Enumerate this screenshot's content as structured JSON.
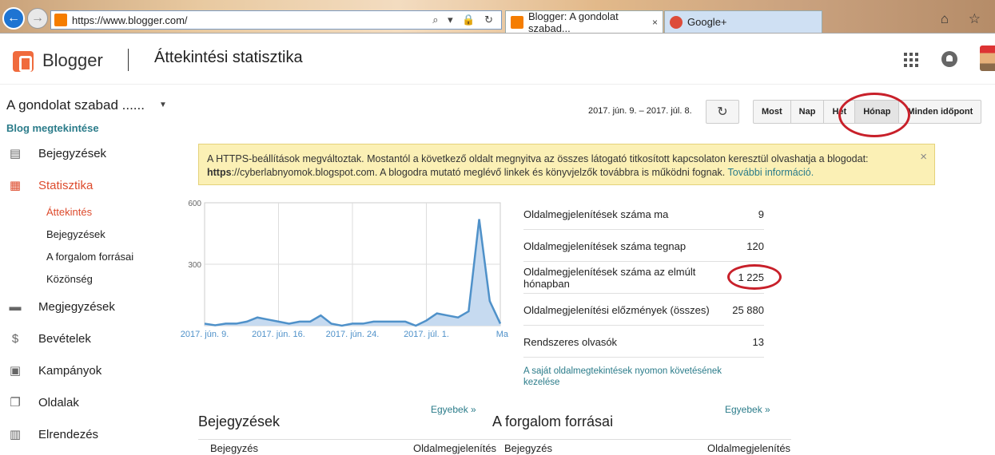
{
  "browser": {
    "url": "https://www.blogger.com/",
    "tabs": [
      {
        "label": "Blogger: A gondolat szabad...",
        "close": "×"
      },
      {
        "label": "Google+",
        "close": ""
      }
    ],
    "url_tools": "⌕ ▾ 🔒 ↻",
    "right_icons": "⌂ ☆"
  },
  "header": {
    "brand": "Blogger",
    "title": "Áttekintési statisztika"
  },
  "sidebar": {
    "blog_name": "A gondolat szabad ......",
    "caret": "▼",
    "view_blog": "Blog megtekintése",
    "items": [
      {
        "label": "Bejegyzések",
        "icon": "posts-icon",
        "glyph": "▤"
      },
      {
        "label": "Statisztika",
        "icon": "stats-icon",
        "glyph": "▦"
      },
      {
        "label": "Megjegyzések",
        "icon": "comments-icon",
        "glyph": "▬"
      },
      {
        "label": "Bevételek",
        "icon": "dollar-icon",
        "glyph": "$"
      },
      {
        "label": "Kampányok",
        "icon": "campaigns-icon",
        "glyph": "▣"
      },
      {
        "label": "Oldalak",
        "icon": "pages-icon",
        "glyph": "❐"
      },
      {
        "label": "Elrendezés",
        "icon": "layout-icon",
        "glyph": "▥"
      }
    ],
    "subitems": [
      "Áttekintés",
      "Bejegyzések",
      "A forgalom forrásai",
      "Közönség"
    ]
  },
  "range": {
    "date_range": "2017. jún. 9. – 2017. júl. 8.",
    "refresh": "↻",
    "buttons": [
      "Most",
      "Nap",
      "Hét",
      "Hónap",
      "Minden időpont"
    ],
    "selected": "Hónap"
  },
  "notice": {
    "text_a": "A HTTPS-beállítások megváltoztak. Mostantól a következő oldalt megnyitva az összes látogató titkosított kapcsolaton keresztül olvashatja a blogodat: ",
    "bold": "https",
    "text_b": "://cyberlabnyomok.blogspot.com. A blogodra mutató meglévő linkek és könyvjelzők továbbra is működni fognak. ",
    "link": "További információ.",
    "close": "×"
  },
  "chart_data": {
    "type": "area",
    "ylim": [
      0,
      600
    ],
    "yticks": [
      "600",
      "300"
    ],
    "xtick_labels": [
      "2017. jún. 9.",
      "2017. jún. 16.",
      "2017. jún. 24.",
      "2017. júl. 1.",
      "Ma"
    ],
    "color": "#4f91c9",
    "fill": "#c6daf0",
    "series": [
      {
        "values": [
          10,
          2,
          10,
          10,
          20,
          40,
          30,
          20,
          10,
          20,
          20,
          50,
          10,
          0,
          10,
          10,
          20,
          20,
          20,
          20,
          0,
          25,
          60,
          50,
          40,
          70,
          520,
          120,
          10
        ]
      }
    ]
  },
  "stats": [
    {
      "label": "Oldalmegjelenítések száma ma",
      "value": "9"
    },
    {
      "label": "Oldalmegjelenítések száma tegnap",
      "value": "120"
    },
    {
      "label": "Oldalmegjelenítések száma az elmúlt hónapban",
      "value": "1 225"
    },
    {
      "label": "Oldalmegjelenítési előzmények (összes)",
      "value": "25 880"
    },
    {
      "label": "Rendszeres olvasók",
      "value": "13"
    }
  ],
  "manage_link": "A saját oldalmegtekintések nyomon követésének kezelése",
  "sections": [
    {
      "title": "Bejegyzések",
      "more": "Egyebek »",
      "col1": "Bejegyzés",
      "col2": "Oldalmegjelenítés"
    },
    {
      "title": "A forgalom forrásai",
      "more": "Egyebek »",
      "col1": "Bejegyzés",
      "col2": "Oldalmegjelenítés"
    }
  ],
  "colors": {
    "accent": "#dd4b2d",
    "link": "#2b7c8a",
    "annotation": "#c8202a"
  }
}
